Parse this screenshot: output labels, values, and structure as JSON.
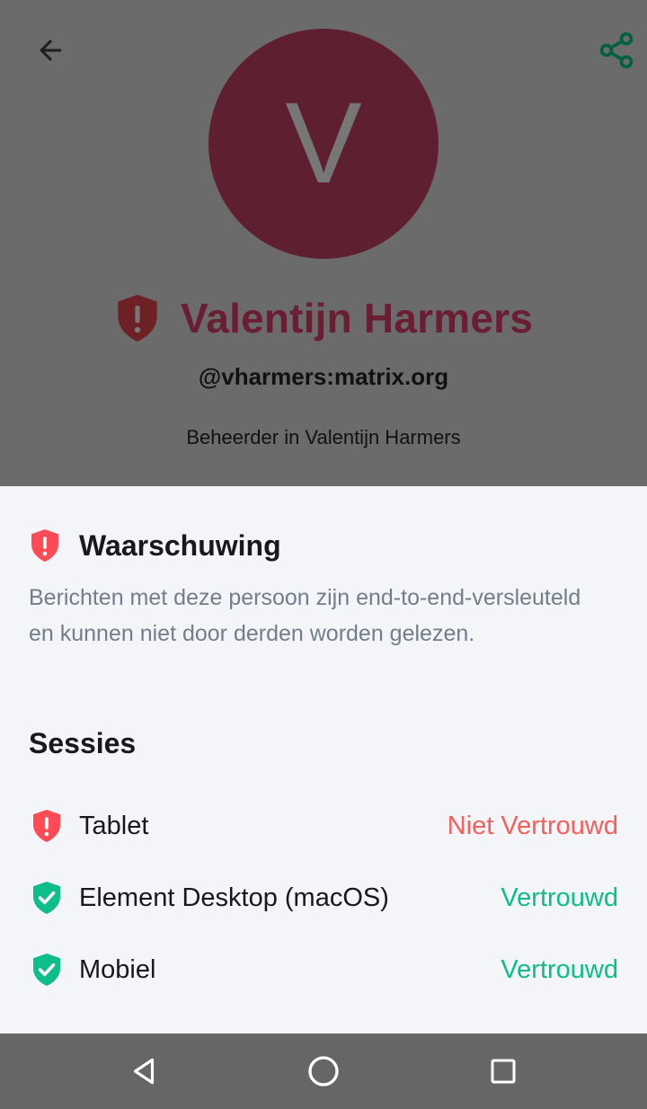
{
  "profile": {
    "avatar_letter": "V",
    "display_name": "Valentijn Harmers",
    "user_id": "@vharmers:matrix.org",
    "role": "Beheerder in Valentijn Harmers",
    "avatar_color": "#5e2030",
    "name_color": "#6a1e33",
    "icons": {
      "back": "arrow-left-icon",
      "share": "share-icon",
      "name_shield": "shield-warning-icon"
    }
  },
  "sheet": {
    "warning_title": "Waarschuwing",
    "warning_description": "Berichten met deze persoon zijn end-to-end-versleuteld en kunnen niet door derden worden gelezen.",
    "sessions_title": "Sessies",
    "sessions": [
      {
        "name": "Tablet",
        "status": "Niet Vertrouwd",
        "trusted": false,
        "icon": "shield-warning-icon"
      },
      {
        "name": "Element Desktop (macOS)",
        "status": "Vertrouwd",
        "trusted": true,
        "icon": "shield-check-icon"
      },
      {
        "name": "Mobiel",
        "status": "Vertrouwd",
        "trusted": true,
        "icon": "shield-check-icon"
      }
    ],
    "colors": {
      "untrusted": "#f4605a",
      "trusted": "#0dbd8b",
      "warning_icon": "#ff4b55"
    }
  },
  "navbar": {
    "icons": {
      "back": "nav-back-icon",
      "home": "nav-home-icon",
      "recents": "nav-recents-icon"
    }
  }
}
